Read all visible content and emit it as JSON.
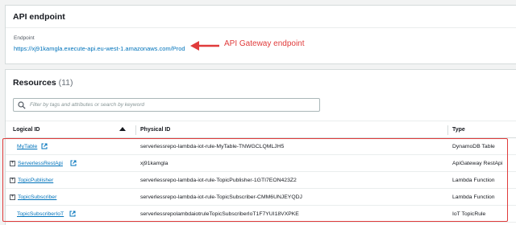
{
  "api_endpoint": {
    "title": "API endpoint",
    "endpoint_label": "Endpoint",
    "endpoint_url": "https://xj91kamgla.execute-api.eu-west-1.amazonaws.com/Prod"
  },
  "annotation": {
    "text": "API Gateway endpoint",
    "color": "#e03b3b"
  },
  "resources": {
    "title": "Resources",
    "count": "(11)",
    "search_placeholder": "Filter by tags and attributes or search by keyword",
    "columns": {
      "logical_id": "Logical ID",
      "physical_id": "Physical ID",
      "type": "Type"
    },
    "rows": [
      {
        "logical_id": "MyTable",
        "expandable": false,
        "physical_id": "serverlessrepo-lambda-iot-rule-MyTable-TNWGCLQMLJH5",
        "type": "DynamoDB Table"
      },
      {
        "logical_id": "ServerlessRestApi",
        "expandable": true,
        "physical_id": "xj91kamgla",
        "type": "ApiGateway RestApi"
      },
      {
        "logical_id": "TopicPublisher",
        "expandable": true,
        "physical_id": "serverlessrepo-lambda-iot-rule-TopicPublisher-1GTI7EON423Z2",
        "type": "Lambda Function"
      },
      {
        "logical_id": "TopicSubscriber",
        "expandable": true,
        "physical_id": "serverlessrepo-lambda-iot-rule-TopicSubscriber-CMM6UNJEYQDJ",
        "type": "Lambda Function"
      },
      {
        "logical_id": "TopicSubscriberIoT",
        "expandable": false,
        "physical_id": "serverlessrepolambdaiotruleTopicSubscriberIoT1F7YUI18VXPKE",
        "type": "IoT TopicRule"
      }
    ]
  },
  "colors": {
    "link": "#0073bb",
    "highlight": "#e03b3b"
  }
}
